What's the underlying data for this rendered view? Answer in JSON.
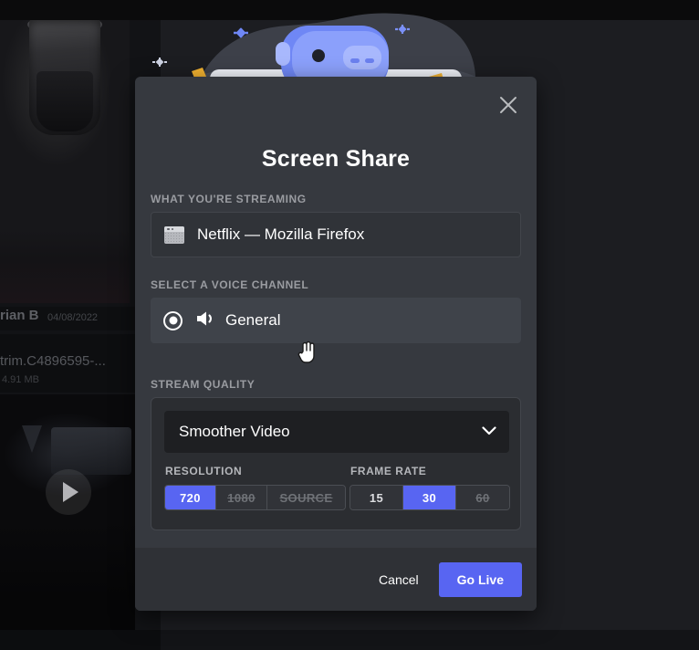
{
  "background": {
    "topbar_text": "",
    "topbar_right_text": "",
    "message_author": "rian B",
    "message_date": "04/08/2022",
    "attachment_name": "trim.C4896595-...",
    "attachment_size": "4.91 MB",
    "photo_alt": "coffee-cup-photo",
    "video_alt": "video-attachment-thumbnail"
  },
  "modal": {
    "title": "Screen Share",
    "close_icon": "close-icon",
    "illustration": "wumpus-couch-movie-night-illustration",
    "streaming": {
      "label": "WHAT YOU'RE STREAMING",
      "icon": "window-icon",
      "value": "Netflix — Mozilla Firefox"
    },
    "voice_channel": {
      "label": "SELECT A VOICE CHANNEL",
      "radio_icon": "radio-selected-icon",
      "speaker_icon": "speaker-icon",
      "name": "General",
      "selected": true
    },
    "quality": {
      "label": "STREAM QUALITY",
      "preset_value": "Smoother Video",
      "preset_chevron": "chevron-down-icon",
      "resolution": {
        "label": "RESOLUTION",
        "options": [
          {
            "label": "720",
            "state": "active"
          },
          {
            "label": "1080",
            "state": "disabled"
          },
          {
            "label": "SOURCE",
            "state": "disabled"
          }
        ]
      },
      "frame_rate": {
        "label": "FRAME RATE",
        "options": [
          {
            "label": "15",
            "state": "normal"
          },
          {
            "label": "30",
            "state": "active"
          },
          {
            "label": "60",
            "state": "disabled"
          }
        ]
      }
    },
    "footer": {
      "cancel_label": "Cancel",
      "go_live_label": "Go Live"
    }
  },
  "colors": {
    "accent": "#5865f2",
    "modal_bg": "#36393f",
    "card_bg": "#2b2d31",
    "input_bg": "#1e1f22",
    "footer_bg": "#2f3136"
  },
  "cursor": {
    "type": "pointer-hand-cursor"
  }
}
